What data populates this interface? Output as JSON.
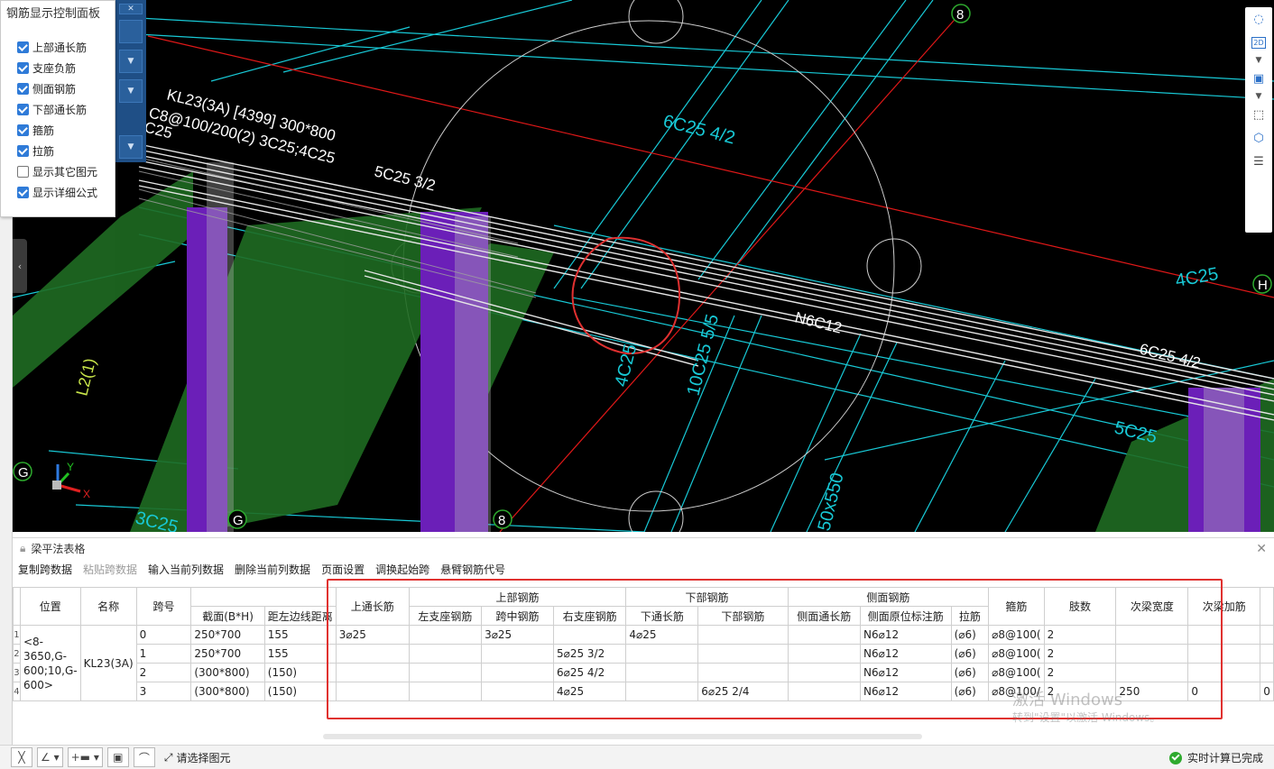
{
  "control_panel": {
    "title": "钢筋显示控制面板",
    "options": [
      {
        "label": "上部通长筋",
        "checked": true
      },
      {
        "label": "支座负筋",
        "checked": true
      },
      {
        "label": "侧面钢筋",
        "checked": true
      },
      {
        "label": "下部通长筋",
        "checked": true
      },
      {
        "label": "箍筋",
        "checked": true
      },
      {
        "label": "拉筋",
        "checked": true
      },
      {
        "label": "显示其它图元",
        "checked": false
      },
      {
        "label": "显示详细公式",
        "checked": true
      }
    ]
  },
  "viewport": {
    "beam_annotation_line1": "KL23(3A) [4399] 300*800",
    "beam_annotation_line2": "C8@100/200(2) 3C25;4C25",
    "beam_annotation_line3": "C25",
    "label_5c25": "5C25 3/2",
    "label_n6c12": "N6C12",
    "label_6c25": "6C25 4/2",
    "label_4c25_right": "4C25",
    "label_5c25_lower": "5C25",
    "label_6c25_top": "6C25 4/2",
    "label_l2": "L2(1)",
    "label_3c25": "3C25",
    "label_50x550": "50x550",
    "label_10c25": "10C25 5/5",
    "label_4c25_left": "4C25",
    "axis_8_top": "8",
    "axis_8_bottom": "8",
    "axis_H": "H",
    "axis_G_left": "G",
    "axis_G_bottom": "G",
    "axis_x": "X",
    "axis_y": "Y"
  },
  "right_toolbar": {
    "icons": [
      "orbit-icon",
      "view-2d-icon",
      "chevron-down-icon",
      "view-3d-box-icon",
      "chevron-down-icon",
      "select-frame-icon",
      "isometric-cube-icon",
      "list-view-icon"
    ],
    "label_2d": "2D"
  },
  "table_panel": {
    "title": "梁平法表格",
    "toolbar": [
      {
        "label": "复制跨数据",
        "enabled": true
      },
      {
        "label": "粘贴跨数据",
        "enabled": false
      },
      {
        "label": "输入当前列数据",
        "enabled": true
      },
      {
        "label": "删除当前列数据",
        "enabled": true
      },
      {
        "label": "页面设置",
        "enabled": true
      },
      {
        "label": "调换起始跨",
        "enabled": true
      },
      {
        "label": "悬臂钢筋代号",
        "enabled": true
      }
    ],
    "group_headers": {
      "top_rebar": "上部钢筋",
      "bottom_rebar": "下部钢筋",
      "side_rebar": "侧面钢筋"
    },
    "columns": {
      "position": "位置",
      "name": "名称",
      "span_no": "跨号",
      "section": "截面(B*H)",
      "edge_dist": "距左边线距离",
      "top_continuous": "上通长筋",
      "left_support": "左支座钢筋",
      "mid_span": "跨中钢筋",
      "right_support": "右支座钢筋",
      "bottom_continuous": "下通长筋",
      "bottom_rebar": "下部钢筋",
      "side_continuous": "侧面通长筋",
      "side_original": "侧面原位标注筋",
      "tie_bar": "拉筋",
      "stirrup": "箍筋",
      "legs": "肢数",
      "secondary_width": "次梁宽度",
      "secondary_add": "次梁加筋"
    },
    "position_value": "<8-3650,G-600;10,G-600>",
    "name_value": "KL23(3A)",
    "row_numbers": [
      "1",
      "2",
      "3",
      "4"
    ],
    "rows": [
      {
        "span": "0",
        "section": "250*700",
        "edge": "155",
        "top_cont": "3⌀25",
        "left_sup": "",
        "mid": "3⌀25",
        "right_sup": "",
        "bot_cont": "4⌀25",
        "bot": "",
        "side_cont": "",
        "side_orig": "N6⌀12",
        "tie": "(⌀6)",
        "stirrup": "⌀8@100(",
        "legs": "2",
        "sec_w": "",
        "sec_add": ""
      },
      {
        "span": "1",
        "section": "250*700",
        "edge": "155",
        "top_cont": "",
        "left_sup": "",
        "mid": "",
        "right_sup": "5⌀25 3/2",
        "bot_cont": "",
        "bot": "",
        "side_cont": "",
        "side_orig": "N6⌀12",
        "tie": "(⌀6)",
        "stirrup": "⌀8@100(",
        "legs": "2",
        "sec_w": "",
        "sec_add": ""
      },
      {
        "span": "2",
        "section": "(300*800)",
        "edge": "(150)",
        "top_cont": "",
        "left_sup": "",
        "mid": "",
        "right_sup": "6⌀25 4/2",
        "bot_cont": "",
        "bot": "",
        "side_cont": "",
        "side_orig": "N6⌀12",
        "tie": "(⌀6)",
        "stirrup": "⌀8@100(",
        "legs": "2",
        "sec_w": "",
        "sec_add": ""
      },
      {
        "span": "3",
        "section": "(300*800)",
        "edge": "(150)",
        "top_cont": "",
        "left_sup": "",
        "mid": "",
        "right_sup": "4⌀25",
        "bot_cont": "",
        "bot": "6⌀25 2/4",
        "side_cont": "",
        "side_orig": "N6⌀12",
        "tie": "(⌀6)",
        "stirrup": "⌀8@100/",
        "legs": "2",
        "sec_w": "250",
        "sec_add": "0",
        "extra": "0"
      }
    ],
    "watermark_line1": "激活 Windows",
    "watermark_line2": "转到\"设置\"以激活 Windows。"
  },
  "status_bar": {
    "select_prompt": "请选择图元",
    "calc_status": "实时计算已完成"
  },
  "colors": {
    "viewport_bg": "#000000",
    "cyan_lines": "#18c9d6",
    "column_purple": "#6b1fb8",
    "beam_green": "#1f6b22",
    "red_box": "#e0312f"
  }
}
